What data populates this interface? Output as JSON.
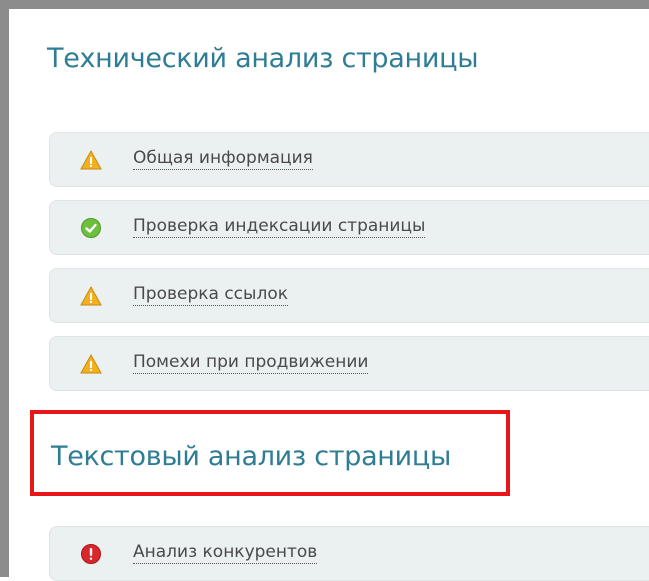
{
  "sections": [
    {
      "title": "Технический анализ страницы",
      "items": [
        {
          "label": "Общая информация",
          "status": "warning"
        },
        {
          "label": "Проверка индексации страницы",
          "status": "ok"
        },
        {
          "label": "Проверка ссылок",
          "status": "warning"
        },
        {
          "label": "Помехи при продвижении",
          "status": "warning"
        }
      ]
    },
    {
      "title": "Текстовый анализ страницы",
      "highlighted": true,
      "items": [
        {
          "label": "Анализ конкурентов",
          "status": "error"
        }
      ]
    }
  ],
  "colors": {
    "title": "#2e7d95",
    "item_background": "#ebf0f1",
    "highlight_border": "#e8151b",
    "frame": "#8c8c8c",
    "warning": "#f2b01e",
    "ok": "#6fbf3f",
    "error": "#d9262b"
  }
}
